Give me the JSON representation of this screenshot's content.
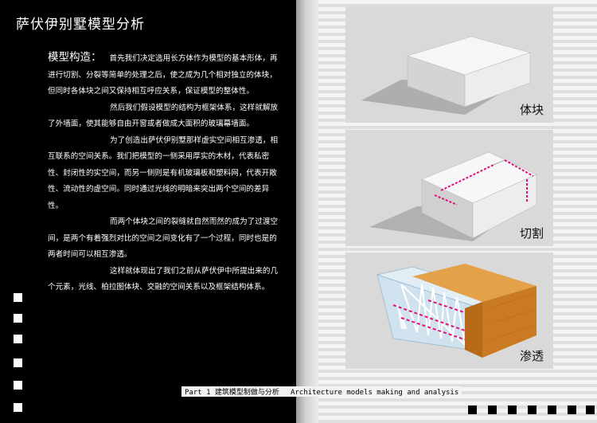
{
  "page": {
    "title": "萨伏伊别墅模型分析",
    "section": {
      "heading": "模型构造：",
      "paragraphs": [
        "首先我们决定选用长方体作为模型的基本形体，再进行切割、分裂等简单的处理之后，使之成为几个相对独立的体块，但同时各体块之间又保持相互呼应关系，保证模型的整体性。",
        "然后我们假设模型的结构为框架体系，这样就解放了外墙面，使其能够自由开窗或者做成大面积的玻璃幕墙面。",
        "为了创造出萨伏伊别墅那样虚实空间相互渗透，相互联系的空间关系。我们把模型的一侧采用厚实的木材，代表私密性、封闭性的实空间，而另一侧则是有机玻璃板和塑料网，代表开敞性、流动性的虚空间。同时通过光线的明暗来突出两个空间的差异性。",
        "而两个体块之间的裂缝就自然而然的成为了过渡空间，是两个有着强烈对比的空间之间变化有了一个过程，同时也是的两者时间可以相互渗透。",
        "这样就体现出了我们之前从萨伏伊中所提出来的几个元素，光线、柏拉图体块、交融的空间关系以及框架结构体系。"
      ]
    },
    "panels": [
      {
        "label": "体块"
      },
      {
        "label": "切割"
      },
      {
        "label": "渗透"
      }
    ],
    "footer": {
      "part": "Part 1 建筑模型制做与分析",
      "english": "Architecture models making and analysis"
    },
    "colors": {
      "background_left": "#000000",
      "accent_dashes": "#e0107a",
      "wood": "#d58a2e"
    }
  }
}
